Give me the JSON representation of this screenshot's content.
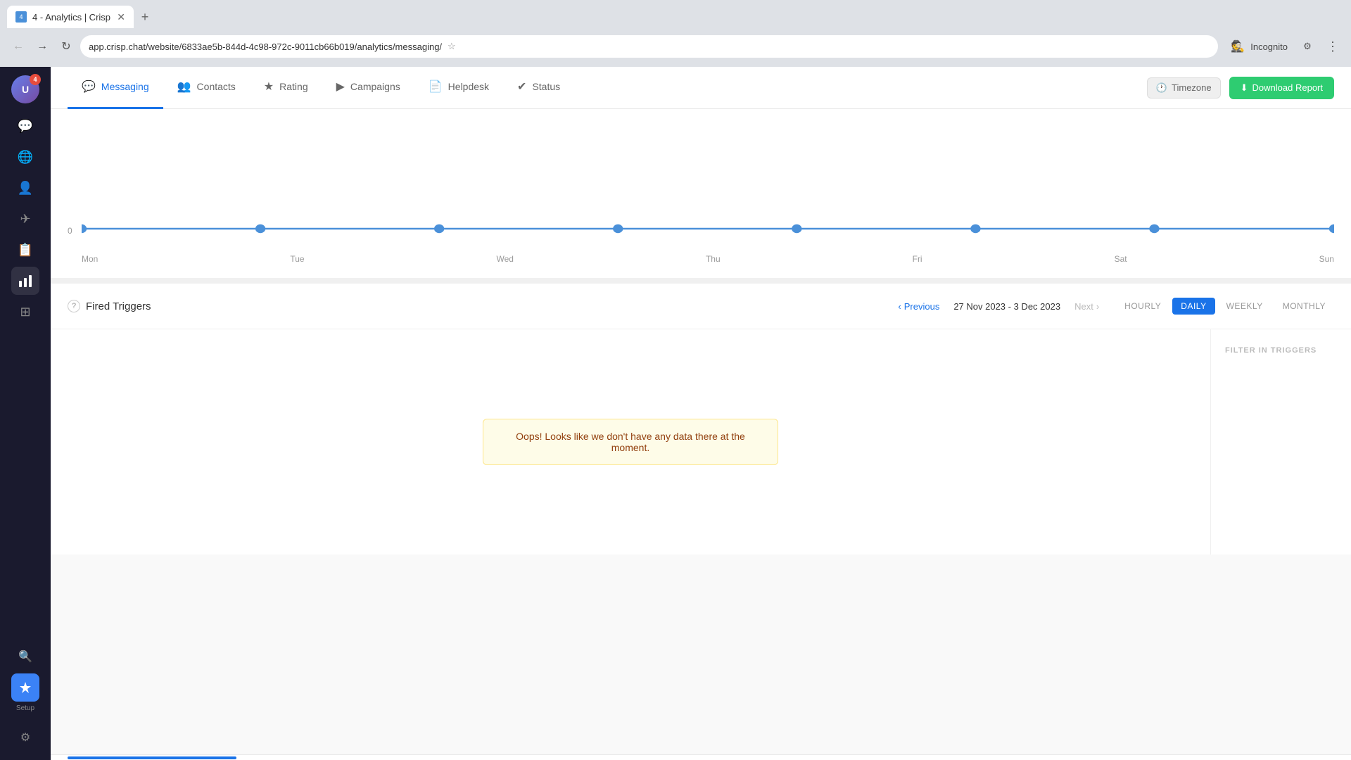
{
  "browser": {
    "tab_title": "4 - Analytics | Crisp",
    "tab_favicon": "4",
    "address_bar": "app.crisp.chat/website/6833ae5b-844d-4c98-972c-9011cb66b019/analytics/messaging/",
    "incognito_label": "Incognito",
    "new_tab_icon": "+"
  },
  "sidebar": {
    "avatar_initials": "U",
    "badge_count": "4",
    "icons": [
      {
        "name": "chat-icon",
        "symbol": "💬",
        "active": false
      },
      {
        "name": "globe-icon",
        "symbol": "🌐",
        "active": false
      },
      {
        "name": "contacts-icon",
        "symbol": "👤",
        "active": false
      },
      {
        "name": "send-icon",
        "symbol": "✈",
        "active": false
      },
      {
        "name": "inbox-icon",
        "symbol": "📋",
        "active": false
      },
      {
        "name": "analytics-icon",
        "symbol": "📊",
        "active": true
      },
      {
        "name": "dashboard-icon",
        "symbol": "⊞",
        "active": false
      }
    ],
    "setup_label": "Setup",
    "setup_icon": "✦",
    "search_icon": "🔍",
    "settings_icon": "⚙"
  },
  "top_nav": {
    "tabs": [
      {
        "id": "messaging",
        "label": "Messaging",
        "icon": "💬",
        "active": true
      },
      {
        "id": "contacts",
        "label": "Contacts",
        "icon": "👥",
        "active": false
      },
      {
        "id": "rating",
        "label": "Rating",
        "icon": "★",
        "active": false
      },
      {
        "id": "campaigns",
        "label": "Campaigns",
        "icon": "▶",
        "active": false
      },
      {
        "id": "helpdesk",
        "label": "Helpdesk",
        "icon": "📄",
        "active": false
      },
      {
        "id": "status",
        "label": "Status",
        "icon": "✔",
        "active": false
      }
    ],
    "timezone_label": "Timezone",
    "download_label": "Download Report",
    "download_icon": "⬇"
  },
  "chart": {
    "y_label": "0",
    "x_labels": [
      "Mon",
      "Tue",
      "Wed",
      "Thu",
      "Fri",
      "Sat",
      "Sun"
    ],
    "data_points": [
      0,
      0,
      0,
      0,
      0,
      0,
      0
    ]
  },
  "fired_triggers": {
    "title": "Fired Triggers",
    "date_range": "27 Nov 2023 - 3 Dec 2023",
    "prev_label": "Previous",
    "next_label": "Next",
    "period_buttons": [
      {
        "id": "hourly",
        "label": "HOURLY",
        "active": false
      },
      {
        "id": "daily",
        "label": "DAILY",
        "active": true
      },
      {
        "id": "weekly",
        "label": "WEEKLY",
        "active": false
      },
      {
        "id": "monthly",
        "label": "MONTHLY",
        "active": false
      }
    ],
    "empty_message": "Oops! Looks like we don't have any data there at the moment.",
    "filter_label": "FILTER IN TRIGGERS"
  }
}
